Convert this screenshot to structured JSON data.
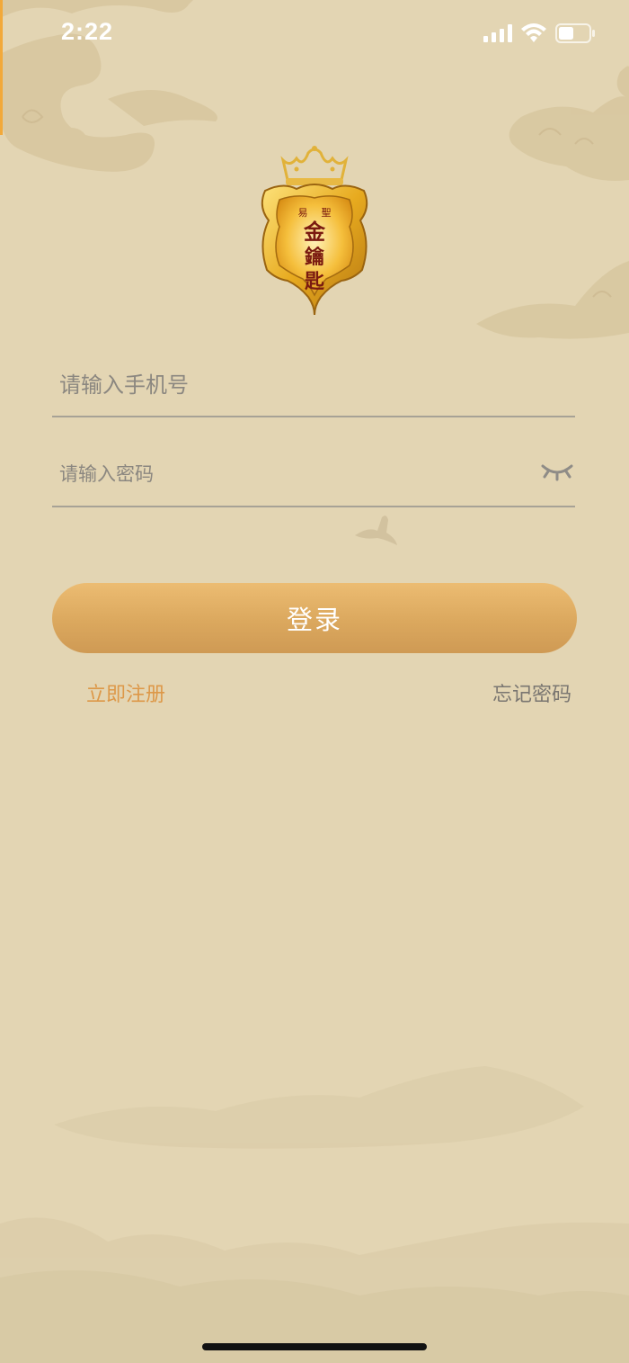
{
  "status_bar": {
    "time": "2:22",
    "icons": [
      "signal-icon",
      "wifi-icon",
      "battery-icon"
    ]
  },
  "logo": {
    "name": "shield-crown-logo",
    "lettering": [
      "易",
      "聖",
      "金",
      "鑰",
      "匙"
    ]
  },
  "login_form": {
    "phone_placeholder": "请输入手机号",
    "password_placeholder": "请输入密码",
    "password_toggle_icon": "eye-closed-icon",
    "login_label": "登录",
    "register_label": "立即注册",
    "forgot_label": "忘记密码"
  },
  "colors": {
    "background": "#e3d5b3",
    "button_gradient_top": "#ecbc72",
    "button_gradient_bottom": "#cf9a54",
    "register_link": "#dd9848",
    "forgot_link": "#7a7671"
  }
}
